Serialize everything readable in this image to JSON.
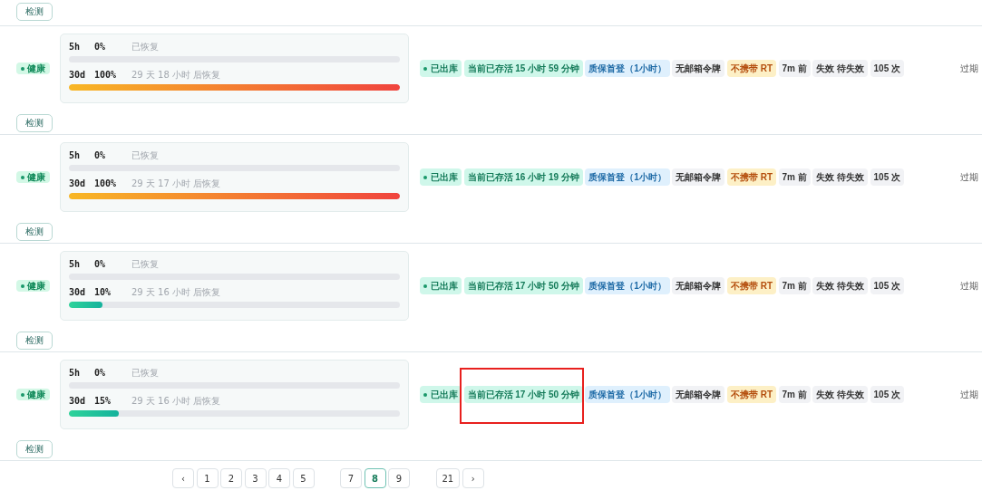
{
  "top_check_button": "检测",
  "rows": [
    {
      "health": "健康",
      "limits": [
        {
          "window": "5h",
          "percent": "0%",
          "note": "已恢复",
          "level": 0
        },
        {
          "window": "30d",
          "percent": "100%",
          "note": "29 天 18 小时 后恢复",
          "level": 1
        }
      ],
      "tags": [
        {
          "kind": "status",
          "text": "已出库"
        },
        {
          "kind": "alive",
          "text": "当前已存活 15 小时 59 分钟"
        },
        {
          "kind": "info",
          "text": "质保首登（1小时）"
        },
        {
          "kind": "neutral",
          "text": "无邮箱令牌"
        },
        {
          "kind": "warn",
          "text": "不携带 RT"
        },
        {
          "kind": "neutral",
          "text": "7m 前"
        },
        {
          "kind": "neutral",
          "text": "失效 待失效"
        },
        {
          "kind": "neutral",
          "text": "105 次"
        }
      ],
      "expiry": "过期",
      "check_button": "检测"
    },
    {
      "health": "健康",
      "limits": [
        {
          "window": "5h",
          "percent": "0%",
          "note": "已恢复",
          "level": 0
        },
        {
          "window": "30d",
          "percent": "100%",
          "note": "29 天 17 小时 后恢复",
          "level": 1
        }
      ],
      "tags": [
        {
          "kind": "status",
          "text": "已出库"
        },
        {
          "kind": "alive",
          "text": "当前已存活 16 小时 19 分钟"
        },
        {
          "kind": "info",
          "text": "质保首登（1小时）"
        },
        {
          "kind": "neutral",
          "text": "无邮箱令牌"
        },
        {
          "kind": "warn",
          "text": "不携带 RT"
        },
        {
          "kind": "neutral",
          "text": "7m 前"
        },
        {
          "kind": "neutral",
          "text": "失效 待失效"
        },
        {
          "kind": "neutral",
          "text": "105 次"
        }
      ],
      "expiry": "过期",
      "check_button": "检测"
    },
    {
      "health": "健康",
      "limits": [
        {
          "window": "5h",
          "percent": "0%",
          "note": "已恢复",
          "level": 0
        },
        {
          "window": "30d",
          "percent": "10%",
          "note": "29 天 16 小时 后恢复",
          "level": 0.1
        }
      ],
      "tags": [
        {
          "kind": "status",
          "text": "已出库"
        },
        {
          "kind": "alive",
          "text": "当前已存活 17 小时 50 分钟"
        },
        {
          "kind": "info",
          "text": "质保首登（1小时）"
        },
        {
          "kind": "neutral",
          "text": "无邮箱令牌"
        },
        {
          "kind": "warn",
          "text": "不携带 RT"
        },
        {
          "kind": "neutral",
          "text": "7m 前"
        },
        {
          "kind": "neutral",
          "text": "失效 待失效"
        },
        {
          "kind": "neutral",
          "text": "105 次"
        }
      ],
      "expiry": "过期",
      "check_button": "检测"
    },
    {
      "health": "健康",
      "limits": [
        {
          "window": "5h",
          "percent": "0%",
          "note": "已恢复",
          "level": 0
        },
        {
          "window": "30d",
          "percent": "15%",
          "note": "29 天 16 小时 后恢复",
          "level": 0.15
        }
      ],
      "tags": [
        {
          "kind": "status",
          "text": "已出库"
        },
        {
          "kind": "alive",
          "text": "当前已存活 17 小时 50 分钟"
        },
        {
          "kind": "info",
          "text": "质保首登（1小时）"
        },
        {
          "kind": "neutral",
          "text": "无邮箱令牌"
        },
        {
          "kind": "warn",
          "text": "不携带 RT"
        },
        {
          "kind": "neutral",
          "text": "7m 前"
        },
        {
          "kind": "neutral",
          "text": "失效 待失效"
        },
        {
          "kind": "neutral",
          "text": "105 次"
        }
      ],
      "expiry": "过期",
      "check_button": "检测",
      "highlighted": true
    }
  ],
  "highlight": {
    "color": "#e8201e"
  },
  "pagination": [
    {
      "label": "‹",
      "selected": false
    },
    {
      "label": "1",
      "selected": false
    },
    {
      "label": "2",
      "selected": false
    },
    {
      "label": "3",
      "selected": false
    },
    {
      "label": "4",
      "selected": false
    },
    {
      "label": "5",
      "selected": false
    },
    {
      "label": "7",
      "selected": false,
      "gap_before": true
    },
    {
      "label": "8",
      "selected": true
    },
    {
      "label": "9",
      "selected": false
    },
    {
      "label": "21",
      "selected": false,
      "gap_before": true
    },
    {
      "label": "›",
      "selected": false
    }
  ]
}
